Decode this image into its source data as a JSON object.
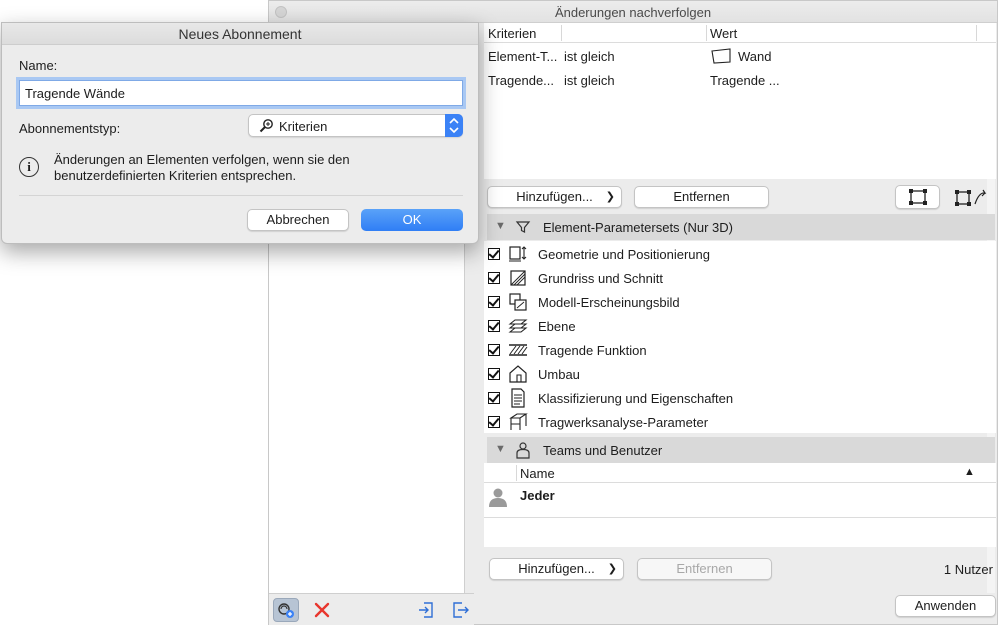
{
  "main_window": {
    "title": "Änderungen nachverfolgen",
    "criteria": {
      "headers": [
        "Kriterien",
        "",
        "Wert"
      ],
      "rows": [
        {
          "criterion": "Element-T...",
          "operator": "ist gleich",
          "value": "Wand"
        },
        {
          "criterion": "Tragende...",
          "operator": "ist gleich",
          "value": "Tragende ..."
        }
      ]
    },
    "add_button": "Hinzufügen...",
    "remove_button": "Entfernen",
    "parametersets_section": {
      "title": "Element-Parametersets (Nur 3D)",
      "items": [
        {
          "label": "Geometrie und Positionierung",
          "icon": "geometry-icon",
          "checked": true
        },
        {
          "label": "Grundriss und Schnitt",
          "icon": "floorplan-icon",
          "checked": true
        },
        {
          "label": "Modell-Erscheinungsbild",
          "icon": "model-appearance-icon",
          "checked": true
        },
        {
          "label": "Ebene",
          "icon": "layer-icon",
          "checked": true
        },
        {
          "label": "Tragende Funktion",
          "icon": "structural-function-icon",
          "checked": true
        },
        {
          "label": "Umbau",
          "icon": "renovation-icon",
          "checked": true
        },
        {
          "label": "Klassifizierung und Eigenschaften",
          "icon": "classification-icon",
          "checked": true
        },
        {
          "label": "Tragwerksanalyse-Parameter",
          "icon": "structural-analysis-icon",
          "checked": true
        }
      ]
    },
    "teams_section": {
      "title": "Teams und Benutzer",
      "column_name": "Name",
      "users": [
        {
          "name": "Jeder"
        }
      ]
    },
    "users_add_button": "Hinzufügen...",
    "users_remove_button": "Entfernen",
    "user_count": "1 Nutzer",
    "apply_button": "Anwenden"
  },
  "dialog": {
    "title": "Neues Abonnement",
    "name_label": "Name:",
    "name_value": "Tragende Wände",
    "type_label": "Abonnementstyp:",
    "type_value": "Kriterien",
    "info_text": "Änderungen an Elementen verfolgen, wenn sie den benutzerdefinierten Kriterien entsprechen.",
    "cancel_button": "Abbrechen",
    "ok_button": "OK"
  },
  "colors": {
    "accent": "#2f7ef5",
    "delete_red": "#e8362d",
    "section_header": "#d9d9d9"
  }
}
